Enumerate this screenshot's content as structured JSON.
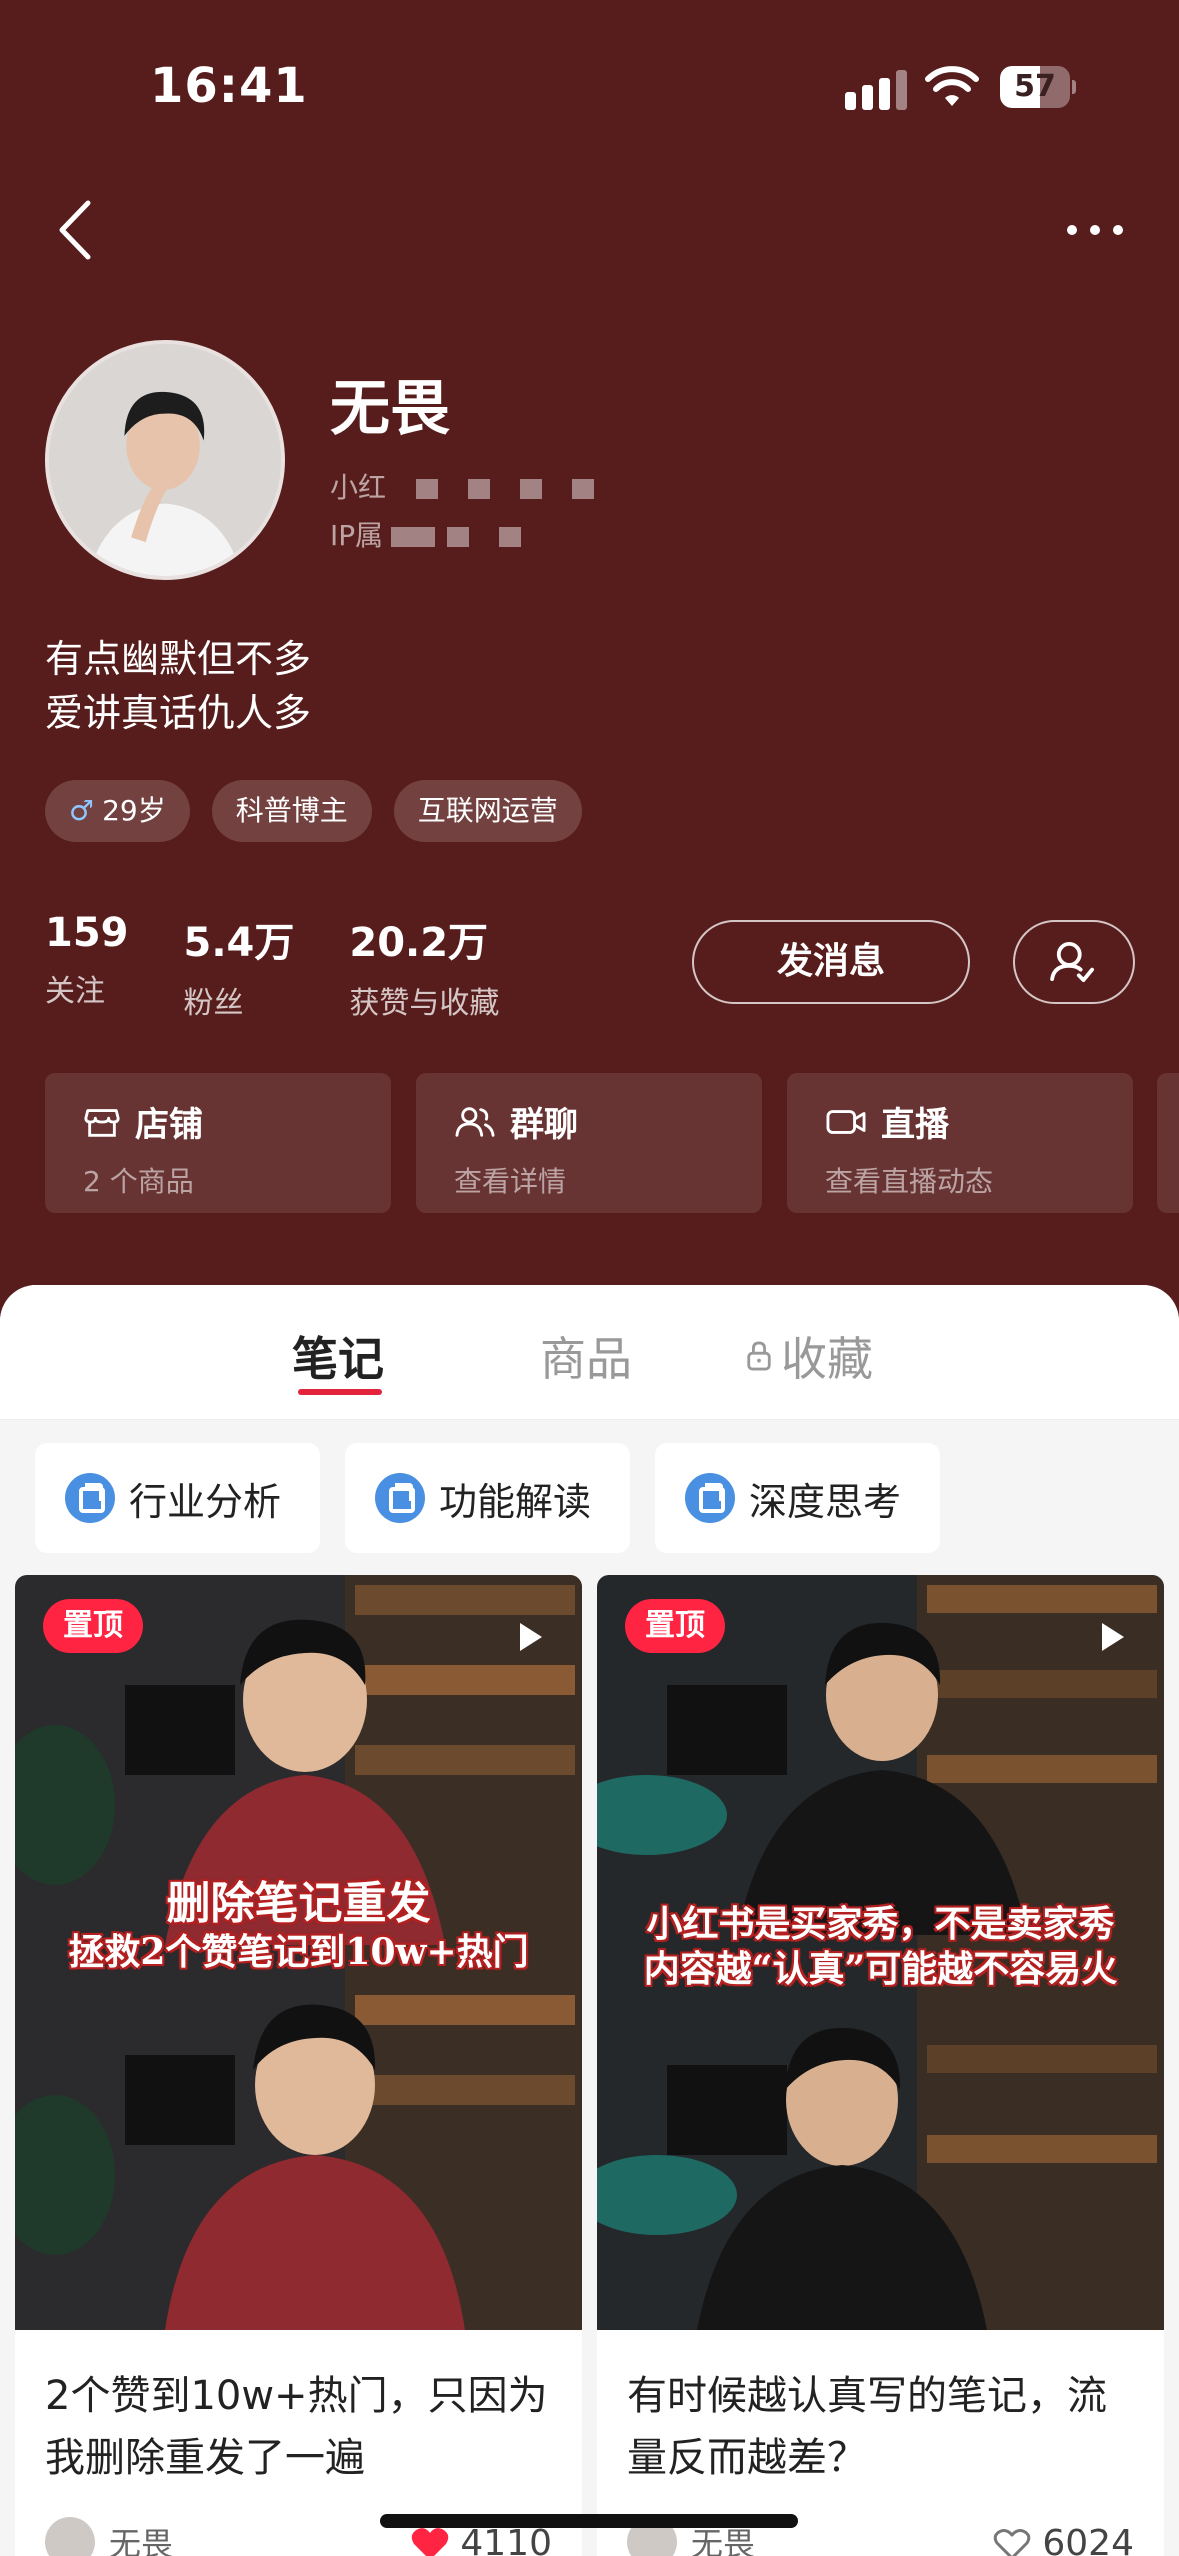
{
  "status_bar": {
    "time": "16:41",
    "battery": "57",
    "battery_level": 0.57
  },
  "profile": {
    "name": "无畏",
    "id_prefix": "小红",
    "ip_prefix": "IP属",
    "bio_line1": "有点幽默但不多",
    "bio_line2": "爱讲真话仇人多",
    "tags": [
      {
        "label": "29岁",
        "icon": "male-icon"
      },
      {
        "label": "科普博主"
      },
      {
        "label": "互联网运营"
      }
    ],
    "stats": [
      {
        "value": "159",
        "label": "关注"
      },
      {
        "value": "5.4万",
        "label": "粉丝"
      },
      {
        "value": "20.2万",
        "label": "获赞与收藏"
      }
    ],
    "message_button": "发消息"
  },
  "quick_cards": [
    {
      "title": "店铺",
      "subtitle": "2 个商品",
      "icon": "store-icon"
    },
    {
      "title": "群聊",
      "subtitle": "查看详情",
      "icon": "group-icon"
    },
    {
      "title": "直播",
      "subtitle": "查看直播动态",
      "icon": "live-icon"
    }
  ],
  "tabs": [
    {
      "label": "笔记",
      "active": true
    },
    {
      "label": "商品",
      "active": false
    },
    {
      "label": "收藏",
      "active": false,
      "icon": "lock-icon"
    }
  ],
  "collections": [
    {
      "label": "行业分析"
    },
    {
      "label": "功能解读"
    },
    {
      "label": "深度思考"
    }
  ],
  "notes": [
    {
      "pin_label": "置顶",
      "cover_text_line1": "删除笔记重发",
      "cover_text_line2": "拯救2个赞笔记到10w+热门",
      "title": "2个赞到10w+热门，只因为我删除重发了一遍",
      "author": "无畏",
      "likes": "4110",
      "liked": true
    },
    {
      "pin_label": "置顶",
      "cover_text_line1": "小红书是买家秀，不是卖家秀",
      "cover_text_line2": "内容越“认真”可能越不容易火",
      "title": "有时候越认真写的笔记，流量反而越差？",
      "author": "无畏",
      "likes": "6024",
      "liked": false
    }
  ],
  "colors": {
    "header_bg": "#571d1c",
    "accent": "#ff2442",
    "tab_underline": "#e3233c"
  }
}
